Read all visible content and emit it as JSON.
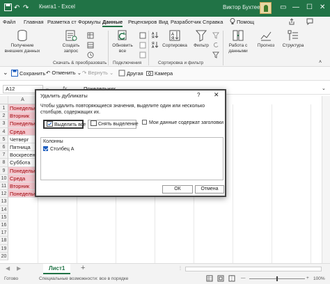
{
  "window": {
    "title": "Книга1  -  Excel",
    "user": "Виктор Бухтеев",
    "save_icon": "save-icon",
    "undo_icon": "undo-icon",
    "redo_icon": "redo-icon"
  },
  "tabs": [
    "Файл",
    "Главная",
    "Разметка ст",
    "Формулы",
    "Данные",
    "Рецензиров",
    "Вид",
    "Разработчик",
    "Справка",
    "Помощ"
  ],
  "active_tab": "Данные",
  "ribbon": {
    "get_data": "Получение внешних данных",
    "create_query": "Создать запрос",
    "refresh_all": "Обновить все",
    "sort": "Сортировка",
    "filter": "Фильтр",
    "data_tools": "Работа с данными",
    "forecast": "Прогноз",
    "outline": "Структура",
    "groups": {
      "transform": "Скачать & преобразовать",
      "connections": "Подключения",
      "sort_filter": "Сортировка и фильтр"
    }
  },
  "quick_access": {
    "save": "Сохранить",
    "undo": "Отменить",
    "redo": "Вернуть",
    "other": "Другая",
    "camera": "Камера"
  },
  "formula_bar": {
    "name_box": "A12",
    "content": "Понедельник"
  },
  "grid": {
    "columns": [
      "A"
    ],
    "rows": [
      "1",
      "2",
      "3",
      "4",
      "5",
      "6",
      "7",
      "8",
      "9",
      "10",
      "11",
      "12",
      "13",
      "14",
      "15",
      "16",
      "17",
      "18",
      "19",
      "20"
    ],
    "cells": [
      "Понедельник",
      "Вторник",
      "Понедельник",
      "Среда",
      "Четверг",
      "Пятница",
      "Воскресенье",
      "Суббота",
      "Понедельник",
      "Среда",
      "Вторник",
      "Понедельник"
    ]
  },
  "sheet": {
    "tab": "Лист1",
    "status_ready": "Готово",
    "accessibility": "Специальные возможности: все в порядке",
    "zoom": "100%"
  },
  "dialog": {
    "title": "Удалить дубликаты",
    "help": "?",
    "description": "Чтобы удалить повторяющиеся значения, выделите один или несколько столбцов, содержащих их.",
    "select_all": "Выделить все",
    "unselect_all": "Снять выделение",
    "has_headers": "Мои данные содержат заголовки",
    "columns_header": "Колонны",
    "column_item": "Столбец A",
    "ok": "ОК",
    "cancel": "Отмена"
  }
}
